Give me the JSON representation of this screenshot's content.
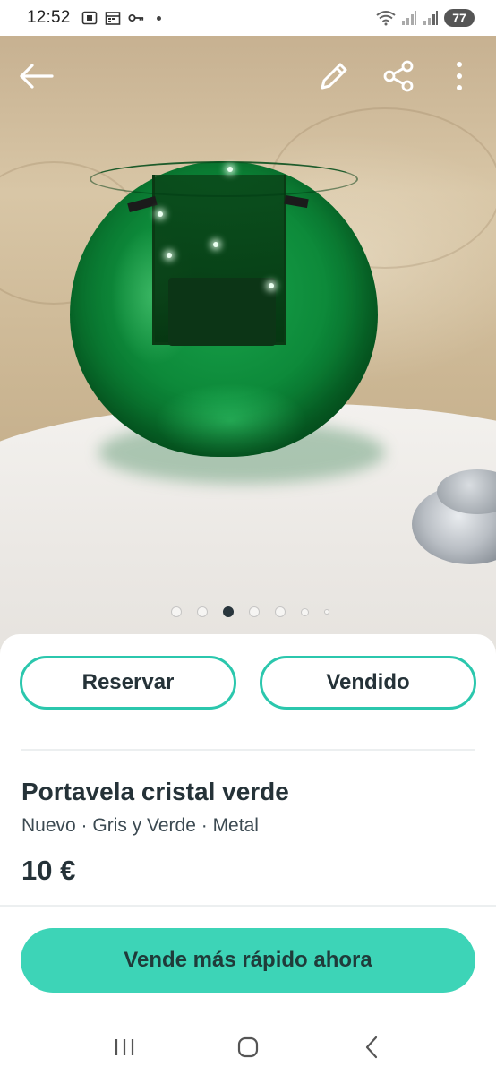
{
  "status_bar": {
    "time": "12:52",
    "battery": "77",
    "icons": [
      "screenshot-icon",
      "calendar-icon",
      "key-icon",
      "notification-dot",
      "wifi-icon",
      "signal-icon",
      "signal-icon",
      "battery-icon"
    ]
  },
  "photo": {
    "current_index": 3,
    "total": 7,
    "description_icon_names": [
      "back-arrow-icon",
      "edit-pencil-icon",
      "share-icon",
      "more-vertical-icon"
    ]
  },
  "actions": {
    "reserve_label": "Reservar",
    "sold_label": "Vendido"
  },
  "product": {
    "title": "Portavela cristal verde",
    "attributes": "Nuevo · Gris y Verde · Metal",
    "price": "10 €"
  },
  "cta": {
    "label": "Vende más rápido ahora"
  },
  "colors": {
    "accent": "#3dd4b7",
    "outline": "#2bc7ad",
    "text": "#253238"
  },
  "nav": {
    "icons": [
      "recents-icon",
      "home-icon",
      "back-icon"
    ]
  }
}
